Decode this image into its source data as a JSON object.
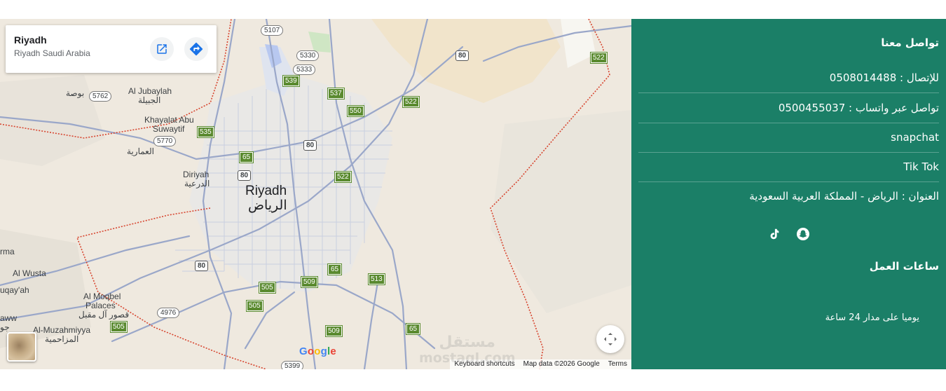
{
  "map": {
    "place_title": "Riyadh",
    "place_subtitle": "Riyadh Saudi Arabia",
    "city_label_en": "Riyadh",
    "city_label_ar": "الرياض",
    "labels": {
      "al_jubaylah_en": "Al Jubaylah",
      "al_jubaylah_ar": "الجبيلة",
      "khayalat_line1": "Khayalat Abu",
      "khayalat_line2": "Suwaytif",
      "diriyah_en": "Diriyah",
      "diriyah_ar": "الدرعية",
      "buwah_ar": "بوصة",
      "ammariyah_ar": "العمارية",
      "rma": "rma",
      "al_wusta": "Al Wusta",
      "uqayah": "uqay'ah",
      "al_moqbel_line1": "Al Moqbel",
      "al_moqbel_line2": "Palaces",
      "al_moqbel_ar": "قصور آل مقبل",
      "aww": "aww",
      "jo": "جو",
      "al_muzahmiyya_en": "Al-Muzahmiyya",
      "al_muzahmiyya_ar": "المزاحمية"
    },
    "road_numbers": {
      "r5107": "5107",
      "r5330": "5330",
      "r5333": "5333",
      "r5762": "5762",
      "r5770": "5770",
      "r4976": "4976",
      "r5399": "5399",
      "r80a": "80",
      "r80b": "80",
      "r80c": "80",
      "r80d": "80",
      "r539": "539",
      "r537": "537",
      "r550": "550",
      "r522a": "522",
      "r522b": "522",
      "r522c": "522",
      "r535": "535",
      "r65a": "65",
      "r65b": "65",
      "r65c": "65",
      "r505a": "505",
      "r505b": "505",
      "r505c": "505",
      "r509a": "509",
      "r509b": "509",
      "r513": "513"
    },
    "google_logo": {
      "g1": "G",
      "o1": "o",
      "o2": "o",
      "g2": "g",
      "l": "l",
      "e": "e"
    },
    "attribution": {
      "keyboard_shortcuts": "Keyboard shortcuts",
      "map_data": "Map data ©2026 Google",
      "terms": "Terms"
    },
    "icons": {
      "open_external": "open-in-new-icon",
      "directions": "directions-icon",
      "fullscreen": "fullscreen-icon"
    }
  },
  "contact": {
    "heading": "تواصل معنا",
    "phone": "للإتصال : 0508014488",
    "whatsapp": "تواصل عبر واتساب : 0500455037",
    "snapchat": "snapchat",
    "tiktok": "Tik Tok",
    "address": "العنوان : الرياض - المملكة العربية السعودية",
    "hours_heading": "ساعات العمل",
    "hours_text": "يوميا على مدار 24 ساعة",
    "social_icons": [
      "tiktok-icon",
      "snapchat-icon"
    ]
  },
  "watermark": {
    "arabic": "مستقل",
    "latin": "mostaql.com"
  },
  "colors": {
    "panel_green": "#1b7f67",
    "map_land": "#efe9df",
    "road": "#9aa7c9",
    "boundary": "#d7452f",
    "highway_shield": "#5a8a2f",
    "google_blue": "#4285f4",
    "google_red": "#ea4335",
    "google_yellow": "#fbbc05",
    "google_green": "#34a853"
  }
}
